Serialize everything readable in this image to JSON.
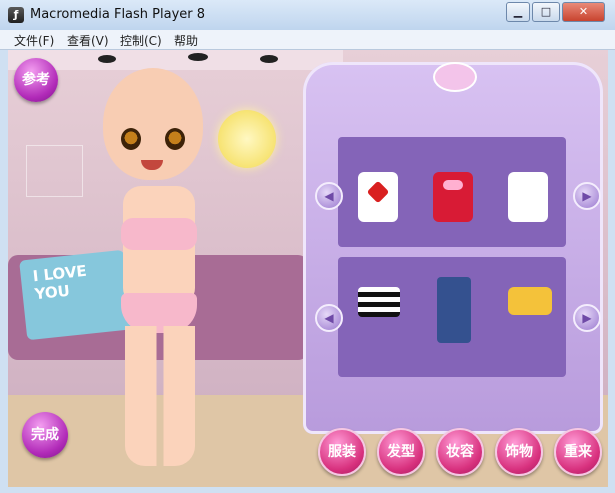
{
  "window": {
    "title": "Macromedia Flash Player 8",
    "icon": "flash-icon"
  },
  "menu": [
    {
      "label": "文件(F)"
    },
    {
      "label": "查看(V)"
    },
    {
      "label": "控制(C)"
    },
    {
      "label": "帮助"
    }
  ],
  "game": {
    "reference_button": "参考",
    "done_button": "完成",
    "pillow_text": "I LOVE YOU",
    "bottom_buttons": [
      "服装",
      "发型",
      "妆容",
      "饰物",
      "重来"
    ]
  },
  "wardrobe": {
    "tops": [
      "heart-tshirt",
      "red-ribbon-top",
      "white-tshirt"
    ],
    "bottoms": [
      "striped-shorts",
      "jeans",
      "yellow-shorts"
    ]
  },
  "colors": {
    "wardrobe": "#b89bdc",
    "button": "#c62f8a"
  }
}
